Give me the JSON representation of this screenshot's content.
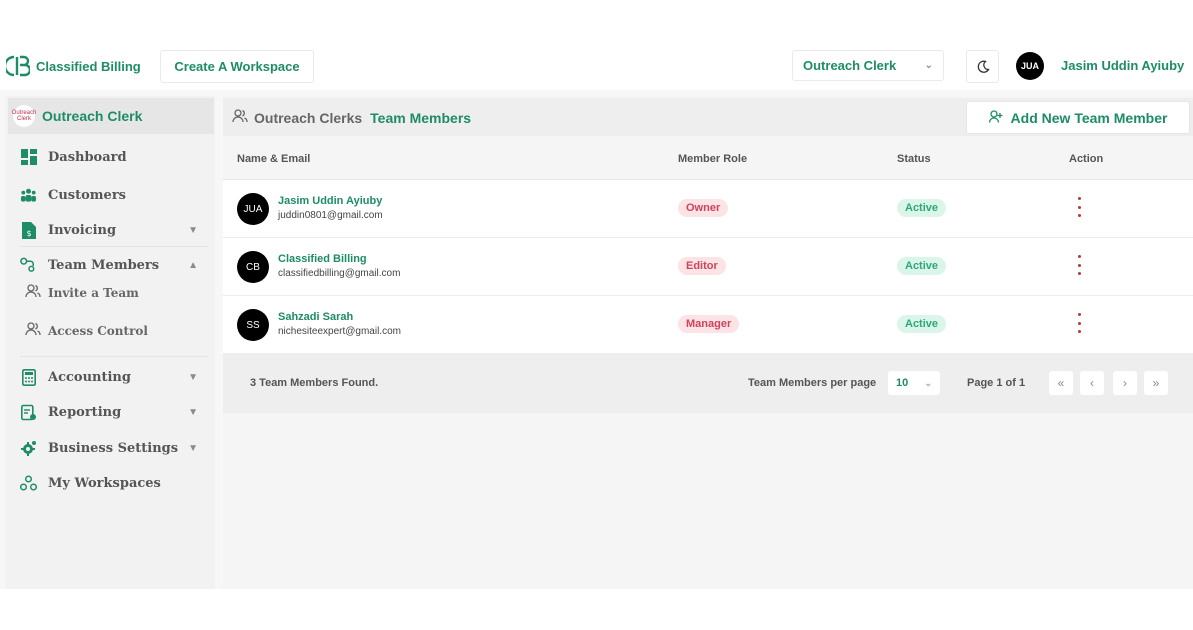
{
  "brand": {
    "name": "Classified Billing",
    "accent": "#1e8c67"
  },
  "topbar": {
    "create_workspace": "Create A Workspace",
    "workspace_selected": "Outreach Clerk",
    "user_initials": "JUA",
    "user_name": "Jasim Uddin Ayiuby",
    "theme_icon": "moon-icon"
  },
  "sidebar": {
    "org_name": "Outreach Clerk",
    "org_logo_text": "Outreach Clerk",
    "items": [
      {
        "label": "Dashboard",
        "icon": "dashboard-icon"
      },
      {
        "label": "Customers",
        "icon": "users-group-icon"
      },
      {
        "label": "Invoicing",
        "icon": "invoice-icon"
      },
      {
        "label": "Team Members",
        "icon": "team-icon"
      },
      {
        "label": "Accounting",
        "icon": "calculator-icon"
      },
      {
        "label": "Reporting",
        "icon": "report-icon"
      },
      {
        "label": "Business Settings",
        "icon": "gear-icon"
      },
      {
        "label": "My Workspaces",
        "icon": "workspaces-icon"
      }
    ],
    "subitems": [
      {
        "label": "Invite a Team",
        "icon": "users-icon"
      },
      {
        "label": "Access Control",
        "icon": "users-icon"
      }
    ]
  },
  "panel": {
    "title_prefix": "Outreach Clerks",
    "title_main": "Team Members",
    "add_button": "Add New Team Member"
  },
  "table": {
    "columns": [
      "Name & Email",
      "Member Role",
      "Status",
      "Action"
    ],
    "rows": [
      {
        "initials": "JUA",
        "name": "Jasim Uddin Ayiuby",
        "email": "juddin0801@gmail.com",
        "role": "Owner",
        "status": "Active"
      },
      {
        "initials": "CB",
        "name": "Classified Billing",
        "email": "classifiedbilling@gmail.com",
        "role": "Editor",
        "status": "Active"
      },
      {
        "initials": "SS",
        "name": "Sahzadi Sarah",
        "email": "nichesiteexpert@gmail.com",
        "role": "Manager",
        "status": "Active"
      }
    ]
  },
  "footer": {
    "found": "3 Team Members Found.",
    "per_page_label": "Team Members per page",
    "per_page_value": "10",
    "page_indicator": "Page 1 of 1"
  }
}
